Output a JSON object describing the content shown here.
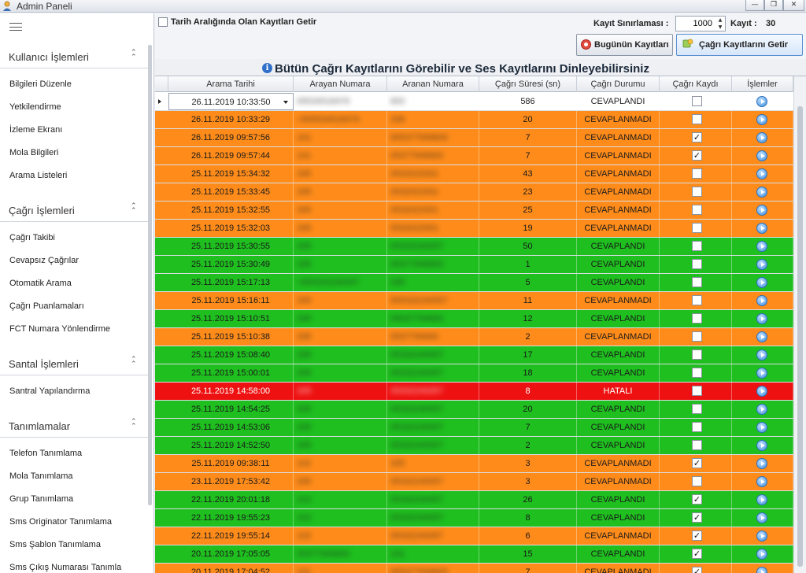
{
  "window": {
    "title": "Admin Paneli"
  },
  "sidebar": {
    "groups": [
      {
        "title": "Kullanıcı İşlemleri",
        "items": [
          "Bilgileri Düzenle",
          "Yetkilendirme",
          "İzleme Ekranı",
          "Mola Bilgileri",
          "Arama Listeleri"
        ]
      },
      {
        "title": "Çağrı İşlemleri",
        "items": [
          "Çağrı Takibi",
          "Cevapsız Çağrılar",
          "Otomatik Arama",
          "Çağrı Puanlamaları",
          "FCT Numara Yönlendirme"
        ]
      },
      {
        "title": "Santal İşlemleri",
        "items": [
          "Santral Yapılandırma"
        ]
      },
      {
        "title": "Tanımlamalar",
        "items": [
          "Telefon Tanımlama",
          "Mola Tanımlama",
          "Grup Tanımlama",
          "Sms Originator Tanımlama",
          "Sms Şablon Tanımlama",
          "Sms Çıkış Numarası Tanımla"
        ]
      }
    ]
  },
  "toolbar": {
    "date_range_label": "Tarih Aralığında Olan Kayıtları Getir",
    "limit_label": "Kayıt Sınırlaması :",
    "limit_value": "1000",
    "count_label": "Kayıt :",
    "count_value": "30",
    "today_button": "Bugünün Kayıtları",
    "fetch_button": "Çağrı Kayıtlarını Getir"
  },
  "heading": "Bütün Çağrı Kayıtlarını Görebilir ve Ses Kayıtlarını Dinleyebilirsiniz",
  "colors": {
    "orange": "#ff8c1a",
    "green": "#1fbf1f",
    "red": "#ee1111",
    "white": "#ffffff"
  },
  "grid": {
    "columns": [
      "Arama Tarihi",
      "Arayan Numara",
      "Aranan Numara",
      "Çağrı Süresi (sn)",
      "Çağrı Durumu",
      "Çağrı Kaydı",
      "İşlemler"
    ],
    "rows": [
      {
        "date": "26.11.2019 10:33:50",
        "caller": "05534518476",
        "callee": "800",
        "duration": "586",
        "status": "CEVAPLANDI",
        "recorded": false,
        "color": "white"
      },
      {
        "date": "26.11.2019 10:33:29",
        "caller": "+905534518476",
        "callee": "338",
        "duration": "20",
        "status": "CEVAPLANMADI",
        "recorded": false,
        "color": "orange"
      },
      {
        "date": "26.11.2019 09:57:56",
        "caller": "101",
        "callee": "905377949600",
        "duration": "7",
        "status": "CEVAPLANMADI",
        "recorded": true,
        "color": "orange"
      },
      {
        "date": "26.11.2019 09:57:44",
        "caller": "101",
        "callee": "05377949600",
        "duration": "7",
        "status": "CEVAPLANMADI",
        "recorded": true,
        "color": "orange"
      },
      {
        "date": "25.11.2019 15:34:32",
        "caller": "335",
        "callee": "0532022001",
        "duration": "43",
        "status": "CEVAPLANMADI",
        "recorded": false,
        "color": "orange"
      },
      {
        "date": "25.11.2019 15:33:45",
        "caller": "335",
        "callee": "0532022001",
        "duration": "23",
        "status": "CEVAPLANMADI",
        "recorded": false,
        "color": "orange"
      },
      {
        "date": "25.11.2019 15:32:55",
        "caller": "335",
        "callee": "0532022001",
        "duration": "25",
        "status": "CEVAPLANMADI",
        "recorded": false,
        "color": "orange"
      },
      {
        "date": "25.11.2019 15:32:03",
        "caller": "335",
        "callee": "0532022001",
        "duration": "19",
        "status": "CEVAPLANMADI",
        "recorded": false,
        "color": "orange"
      },
      {
        "date": "25.11.2019 15:30:55",
        "caller": "335",
        "callee": "05332240057",
        "duration": "50",
        "status": "CEVAPLANDI",
        "recorded": false,
        "color": "green"
      },
      {
        "date": "25.11.2019 15:30:49",
        "caller": "335",
        "callee": "05377949600",
        "duration": "1",
        "status": "CEVAPLANDI",
        "recorded": false,
        "color": "green"
      },
      {
        "date": "25.11.2019 15:17:13",
        "caller": "+905332240057",
        "callee": "335",
        "duration": "5",
        "status": "CEVAPLANDI",
        "recorded": false,
        "color": "green"
      },
      {
        "date": "25.11.2019 15:16:11",
        "caller": "335",
        "callee": "905332240057",
        "duration": "11",
        "status": "CEVAPLANMADI",
        "recorded": false,
        "color": "orange"
      },
      {
        "date": "25.11.2019 15:10:51",
        "caller": "335",
        "callee": "05037794900",
        "duration": "12",
        "status": "CEVAPLANDI",
        "recorded": false,
        "color": "green"
      },
      {
        "date": "25.11.2019 15:10:38",
        "caller": "335",
        "callee": "0537794900",
        "duration": "2",
        "status": "CEVAPLANMADI",
        "recorded": false,
        "color": "orange"
      },
      {
        "date": "25.11.2019 15:08:40",
        "caller": "335",
        "callee": "05332240057",
        "duration": "17",
        "status": "CEVAPLANDI",
        "recorded": false,
        "color": "green"
      },
      {
        "date": "25.11.2019 15:00:01",
        "caller": "335",
        "callee": "05332240057",
        "duration": "18",
        "status": "CEVAPLANDI",
        "recorded": false,
        "color": "green"
      },
      {
        "date": "25.11.2019 14:58:00",
        "caller": "335",
        "callee": "05332240057",
        "duration": "8",
        "status": "HATALI",
        "recorded": false,
        "color": "red"
      },
      {
        "date": "25.11.2019 14:54:25",
        "caller": "335",
        "callee": "05332240057",
        "duration": "20",
        "status": "CEVAPLANDI",
        "recorded": false,
        "color": "green"
      },
      {
        "date": "25.11.2019 14:53:06",
        "caller": "335",
        "callee": "05332240057",
        "duration": "7",
        "status": "CEVAPLANDI",
        "recorded": false,
        "color": "green"
      },
      {
        "date": "25.11.2019 14:52:50",
        "caller": "335",
        "callee": "05332240057",
        "duration": "2",
        "status": "CEVAPLANDI",
        "recorded": false,
        "color": "green"
      },
      {
        "date": "25.11.2019 09:38:11",
        "caller": "102",
        "callee": "335",
        "duration": "3",
        "status": "CEVAPLANMADI",
        "recorded": true,
        "color": "orange"
      },
      {
        "date": "23.11.2019 17:53:42",
        "caller": "335",
        "callee": "05332240057",
        "duration": "3",
        "status": "CEVAPLANMADI",
        "recorded": false,
        "color": "orange"
      },
      {
        "date": "22.11.2019 20:01:18",
        "caller": "102",
        "callee": "05332240057",
        "duration": "26",
        "status": "CEVAPLANDI",
        "recorded": true,
        "color": "green"
      },
      {
        "date": "22.11.2019 19:55:23",
        "caller": "102",
        "callee": "05332240057",
        "duration": "8",
        "status": "CEVAPLANDI",
        "recorded": true,
        "color": "green"
      },
      {
        "date": "22.11.2019 19:55:14",
        "caller": "102",
        "callee": "05332240057",
        "duration": "6",
        "status": "CEVAPLANMADI",
        "recorded": true,
        "color": "orange"
      },
      {
        "date": "20.11.2019 17:05:05",
        "caller": "05377949600",
        "callee": "101",
        "duration": "15",
        "status": "CEVAPLANDI",
        "recorded": true,
        "color": "green"
      },
      {
        "date": "20.11.2019 17:04:52",
        "caller": "101",
        "callee": "905377949600",
        "duration": "7",
        "status": "CEVAPLANMADI",
        "recorded": true,
        "color": "orange"
      }
    ]
  }
}
